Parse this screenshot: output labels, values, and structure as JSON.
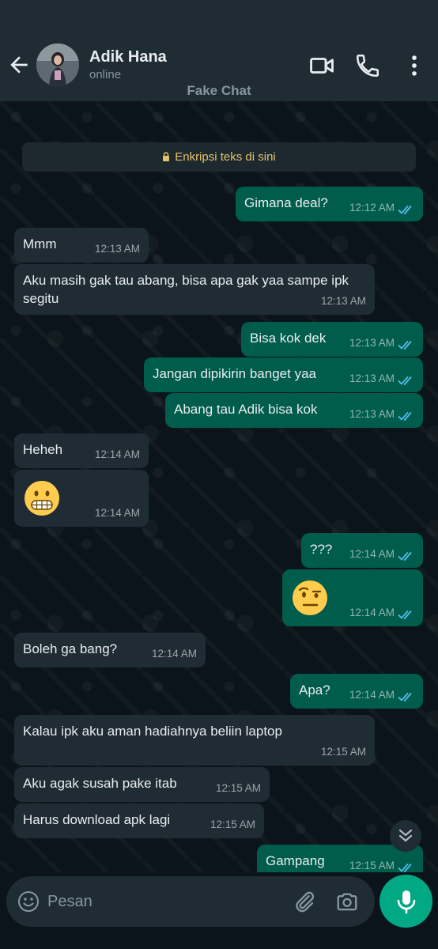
{
  "header": {
    "contact_name": "Adik Hana",
    "status": "online",
    "label": "Fake Chat",
    "icons": [
      "back-arrow-icon",
      "video-call-icon",
      "voice-call-icon",
      "more-options-icon"
    ]
  },
  "encryption_notice": "Enkripsi teks di sini",
  "messages": [
    {
      "dir": "out",
      "text": "Gimana deal?",
      "time": "12:12 AM",
      "read": true
    },
    {
      "dir": "in",
      "text": "Mmm",
      "time": "12:13 AM"
    },
    {
      "dir": "in",
      "text": "Aku masih gak tau abang, bisa apa gak yaa sampe ipk segitu",
      "time": "12:13 AM"
    },
    {
      "dir": "out",
      "text": "Bisa kok dek",
      "time": "12:13 AM",
      "read": true
    },
    {
      "dir": "out",
      "text": "Jangan dipikirin banget yaa",
      "time": "12:13 AM",
      "read": true
    },
    {
      "dir": "out",
      "text": "Abang tau Adik bisa kok",
      "time": "12:13 AM",
      "read": true
    },
    {
      "dir": "in",
      "text": "Heheh",
      "time": "12:14 AM"
    },
    {
      "dir": "in",
      "emoji": "grimacing-face",
      "time": "12:14 AM"
    },
    {
      "dir": "out",
      "text": "???",
      "time": "12:14 AM",
      "read": true
    },
    {
      "dir": "out",
      "emoji": "raised-eyebrow-face",
      "time": "12:14 AM",
      "read": true
    },
    {
      "dir": "in",
      "text": "Boleh ga bang?",
      "time": "12:14 AM"
    },
    {
      "dir": "out",
      "text": "Apa?",
      "time": "12:14 AM",
      "read": true
    },
    {
      "dir": "in",
      "text": "Kalau ipk aku aman hadiahnya beliin laptop",
      "time": "12:15 AM"
    },
    {
      "dir": "in",
      "text": "Aku agak susah pake itab",
      "time": "12:15 AM"
    },
    {
      "dir": "in",
      "text": "Harus download apk lagi",
      "time": "12:15 AM"
    },
    {
      "dir": "out",
      "text": "Gampang",
      "time": "12:15 AM",
      "read": true
    }
  ],
  "composer": {
    "placeholder": "Pesan",
    "icons": [
      "emoji-icon",
      "attach-icon",
      "camera-icon",
      "mic-icon"
    ]
  },
  "colors": {
    "header_bg": "#1f2c34",
    "chat_bg": "#0b141a",
    "incoming_bubble": "#1f2c34",
    "outgoing_bubble": "#005c4b",
    "read_tick": "#53bdeb",
    "accent": "#00a884",
    "encryption_text": "#e2c36b"
  }
}
